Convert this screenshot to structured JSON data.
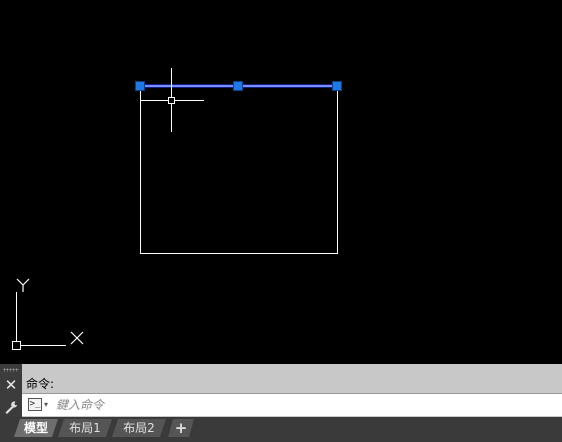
{
  "command": {
    "history_text": "命令:",
    "input_placeholder": "鍵入命令",
    "input_value": "",
    "prompt_glyph": ">_",
    "close_glyph": "✕"
  },
  "tabs": [
    {
      "label": "模型",
      "active": true
    },
    {
      "label": "布局1",
      "active": false
    },
    {
      "label": "布局2",
      "active": false
    },
    {
      "label": "+",
      "active": false
    }
  ],
  "ucs": {
    "x_label": "X",
    "y_label": "Y"
  },
  "colors": {
    "canvas_background": "#000000",
    "geometry_lines": "#ffffff",
    "selected_line": "#1f3fff",
    "grip_fill": "#1e78e6"
  },
  "icons": {
    "close": "close-icon",
    "customize": "wrench-icon",
    "command_prompt": "command-prompt-icon",
    "crosshair": "crosshair-cursor-icon"
  }
}
